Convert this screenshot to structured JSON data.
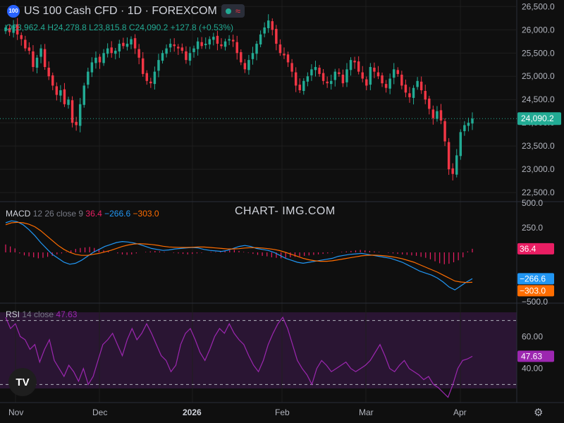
{
  "header": {
    "symbol_badge": "100",
    "title": "US 100 Cash CFD · 1D · FOREXCOM",
    "waves_glyph": "≈",
    "icons": [
      "market-open-dot-icon",
      "waves-icon"
    ]
  },
  "ohlc": {
    "o_label": "O",
    "o": "23,962.4",
    "h_label": "H",
    "h": "24,278.8",
    "l_label": "L",
    "l": "23,815.8",
    "c_label": "C",
    "c": "24,090.2",
    "change": "+127.8 (+0.53%)"
  },
  "macd_legend": {
    "name": "MACD",
    "params": "12 26 close 9",
    "v1": "36.4",
    "v2": "−266.6",
    "v3": "−303.0"
  },
  "rsi_legend": {
    "name": "RSI",
    "params": "14 close",
    "value": "47.63"
  },
  "watermark": "CHART- IMG.COM",
  "logo_text": "TV",
  "settings_glyph": "⚙",
  "colors": {
    "background": "#0f0f0f",
    "up": "#22ab94",
    "down": "#f23645",
    "macd": "#2196f3",
    "signal": "#ff6d00",
    "hist": "#e91e63",
    "rsi": "#9c27b0",
    "rsi_band": "#2a1533",
    "grid": "#1e1e1e"
  },
  "chart_data": [
    {
      "type": "candlestick",
      "title": "US 100 Cash CFD · 1D · FOREXCOM",
      "x_labels": [
        "Nov",
        "Dec",
        "2026",
        "Feb",
        "Mar",
        "Apr"
      ],
      "y_ticks": [
        "26,500.0",
        "26,000.0",
        "25,500.0",
        "25,000.0",
        "24,500.0",
        "24,000.0",
        "23,500.0",
        "23,000.0",
        "22,500.0"
      ],
      "ylim": [
        22350,
        26550
      ],
      "last_price": "24,090.2",
      "closes": [
        26050,
        25950,
        26100,
        25900,
        25800,
        25600,
        25550,
        25200,
        25400,
        25600,
        25200,
        25000,
        24800,
        24600,
        24700,
        24400,
        24500,
        24000,
        23950,
        24400,
        24800,
        25100,
        25300,
        25400,
        25300,
        25500,
        25600,
        25500,
        25550,
        25700,
        25650,
        25700,
        25800,
        25600,
        25400,
        25050,
        24900,
        24850,
        25100,
        25350,
        25500,
        25600,
        25700,
        25650,
        25600,
        25550,
        25350,
        25500,
        25600,
        25750,
        25650,
        25700,
        25800,
        25850,
        25700,
        25650,
        25750,
        25800,
        25750,
        25500,
        25300,
        25150,
        25350,
        25500,
        25700,
        25900,
        26050,
        26200,
        26000,
        25700,
        25500,
        25450,
        25300,
        25100,
        24800,
        24700,
        24900,
        25000,
        25150,
        25200,
        25050,
        24900,
        24850,
        24900,
        25100,
        25050,
        24850,
        25150,
        25350,
        25300,
        25100,
        24950,
        24800,
        25200,
        25100,
        25000,
        24850,
        24750,
        24950,
        25150,
        25050,
        24800,
        24650,
        24550,
        24750,
        24900,
        24700,
        24500,
        24300,
        24100,
        24250,
        24050,
        23600,
        23000,
        22900,
        23300,
        23800,
        23950,
        24000,
        24090
      ],
      "series": [
        {
          "name": "O",
          "values": [
            "23,962.4"
          ]
        },
        {
          "name": "H",
          "values": [
            "24,278.8"
          ]
        },
        {
          "name": "L",
          "values": [
            "23,815.8"
          ]
        },
        {
          "name": "C",
          "values": [
            "24,090.2"
          ]
        }
      ]
    },
    {
      "type": "line",
      "title": "MACD 12 26 close 9",
      "y_ticks": [
        "500.0",
        "250.0",
        "−500.0"
      ],
      "ylim": [
        -500,
        500
      ],
      "histogram": [
        80,
        60,
        40,
        -10,
        -30,
        -40,
        -50,
        -60,
        -55,
        -45,
        -35,
        -20,
        -10,
        5,
        20,
        35,
        45,
        50,
        55,
        45,
        35,
        20,
        10,
        0,
        -10,
        -20,
        -25,
        -20,
        -10,
        0,
        5,
        10,
        15,
        10,
        5,
        0,
        -5,
        -10,
        -15,
        -20,
        -15,
        -10,
        -5,
        0,
        5,
        5,
        10,
        15,
        20,
        25,
        15,
        5,
        -5,
        -15,
        -25,
        -35,
        -40,
        -50,
        -55,
        -60,
        -55,
        -50,
        -45,
        -40,
        -35,
        -30,
        -25,
        -20,
        -15,
        -10,
        -5,
        0,
        5,
        10,
        15,
        20,
        25,
        20,
        15,
        10,
        5,
        0,
        -5,
        -10,
        -15,
        -20,
        -25,
        -30,
        -35,
        -45,
        -55,
        -70,
        -90,
        -110,
        -120,
        -115,
        -100,
        -80,
        -50,
        10,
        36.4
      ],
      "series": [
        {
          "name": "MACD",
          "values": [
            300,
            320,
            310,
            280,
            230,
            170,
            100,
            40,
            -20,
            -60,
            -100,
            -120,
            -110,
            -80,
            -40,
            0,
            30,
            60,
            80,
            100,
            110,
            105,
            95,
            80,
            60,
            40,
            30,
            20,
            25,
            35,
            40,
            45,
            50,
            45,
            30,
            20,
            15,
            10,
            20,
            40,
            60,
            70,
            60,
            40,
            30,
            20,
            0,
            -30,
            -60,
            -80,
            -100,
            -110,
            -100,
            -90,
            -80,
            -70,
            -60,
            -40,
            -30,
            -20,
            -15,
            -10,
            -20,
            -30,
            -40,
            -50,
            -60,
            -80,
            -100,
            -130,
            -160,
            -190,
            -210,
            -230,
            -260,
            -300,
            -350,
            -380,
            -340,
            -300,
            -266.6
          ]
        },
        {
          "name": "Signal",
          "values": [
            280,
            300,
            305,
            300,
            285,
            260,
            220,
            170,
            120,
            70,
            30,
            0,
            -20,
            -30,
            -30,
            -20,
            -10,
            5,
            20,
            40,
            60,
            75,
            85,
            88,
            85,
            80,
            72,
            62,
            55,
            52,
            50,
            50,
            52,
            54,
            54,
            50,
            45,
            40,
            35,
            35,
            38,
            44,
            48,
            48,
            44,
            38,
            30,
            18,
            0,
            -20,
            -40,
            -60,
            -75,
            -85,
            -90,
            -90,
            -85,
            -75,
            -65,
            -55,
            -45,
            -35,
            -30,
            -28,
            -30,
            -35,
            -42,
            -52,
            -65,
            -82,
            -100,
            -125,
            -150,
            -175,
            -200,
            -230,
            -260,
            -290,
            -300,
            -305,
            -303
          ]
        }
      ]
    },
    {
      "type": "line",
      "title": "RSI 14 close",
      "y_ticks": [
        "60.00",
        "40.00"
      ],
      "ylim": [
        20,
        80
      ],
      "bands": [
        70,
        30
      ],
      "series": [
        {
          "name": "RSI",
          "values": [
            72,
            65,
            68,
            60,
            58,
            52,
            55,
            44,
            52,
            58,
            45,
            40,
            35,
            42,
            38,
            32,
            40,
            30,
            35,
            45,
            55,
            58,
            62,
            55,
            48,
            58,
            65,
            58,
            62,
            68,
            62,
            55,
            48,
            45,
            38,
            42,
            55,
            62,
            65,
            58,
            50,
            45,
            52,
            60,
            65,
            62,
            68,
            62,
            58,
            55,
            48,
            42,
            38,
            45,
            55,
            62,
            68,
            72,
            65,
            55,
            45,
            40,
            36,
            30,
            40,
            45,
            42,
            38,
            40,
            42,
            44,
            40,
            38,
            40,
            42,
            45,
            50,
            55,
            48,
            40,
            38,
            42,
            45,
            40,
            38,
            36,
            33,
            35,
            30,
            28,
            25,
            22,
            30,
            40,
            45,
            46,
            47.63
          ]
        }
      ]
    }
  ]
}
